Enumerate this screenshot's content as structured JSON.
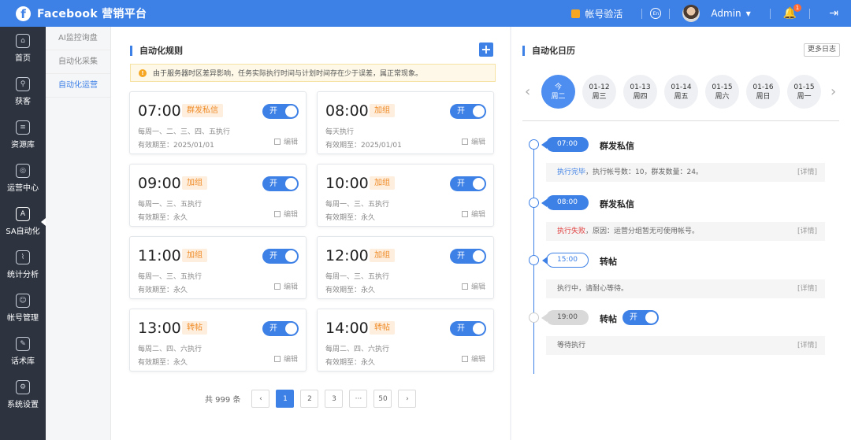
{
  "header": {
    "logo": "f",
    "title": "Facebook 营销平台",
    "verify": "帐号验活",
    "lang": "En",
    "user": "Admin",
    "bell_count": "1"
  },
  "sidebar": {
    "items": [
      {
        "label": "首页",
        "icon": "home-icon"
      },
      {
        "label": "获客",
        "icon": "acquire-icon"
      },
      {
        "label": "资源库",
        "icon": "database-icon"
      },
      {
        "label": "运营中心",
        "icon": "operation-icon"
      },
      {
        "label": "SA自动化",
        "icon": "automation-icon"
      },
      {
        "label": "统计分析",
        "icon": "chart-icon"
      },
      {
        "label": "帐号管理",
        "icon": "account-icon"
      },
      {
        "label": "话术库",
        "icon": "script-icon"
      },
      {
        "label": "系统设置",
        "icon": "settings-icon"
      }
    ],
    "active_index": 4
  },
  "subnav": {
    "items": [
      "AI监控询盘",
      "自动化采集",
      "自动化运营"
    ],
    "active_index": 2
  },
  "rules": {
    "title": "自动化规则",
    "notice": "由于服务器时区差异影响，任务实际执行时间与计划时间存在少于误差，属正常现象。",
    "cards": [
      {
        "time": "07:00",
        "tag": "群发私信",
        "toggle": "开",
        "schedule": "每周一、二、三、四、五执行",
        "valid": "有效期至：2025/01/01",
        "edit": "编辑"
      },
      {
        "time": "08:00",
        "tag": "加组",
        "toggle": "开",
        "schedule": "每天执行",
        "valid": "有效期至：2025/01/01",
        "edit": "编辑"
      },
      {
        "time": "09:00",
        "tag": "加组",
        "toggle": "开",
        "schedule": "每周一、三、五执行",
        "valid": "有效期至：永久",
        "edit": "编辑"
      },
      {
        "time": "10:00",
        "tag": "加组",
        "toggle": "开",
        "schedule": "每周一、三、五执行",
        "valid": "有效期至：永久",
        "edit": "编辑"
      },
      {
        "time": "11:00",
        "tag": "加组",
        "toggle": "开",
        "schedule": "每周一、三、五执行",
        "valid": "有效期至：永久",
        "edit": "编辑"
      },
      {
        "time": "12:00",
        "tag": "加组",
        "toggle": "开",
        "schedule": "每周一、三、五执行",
        "valid": "有效期至：永久",
        "edit": "编辑"
      },
      {
        "time": "13:00",
        "tag": "转帖",
        "toggle": "开",
        "schedule": "每周二、四、六执行",
        "valid": "有效期至：永久",
        "edit": "编辑"
      },
      {
        "time": "14:00",
        "tag": "转帖",
        "toggle": "开",
        "schedule": "每周二、四、六执行",
        "valid": "有效期至：永久",
        "edit": "编辑"
      }
    ],
    "pagination": {
      "total": "共 999 条",
      "prev": "‹",
      "pages": [
        "1",
        "2",
        "3",
        "···",
        "50"
      ],
      "active_page": "1",
      "next": "›"
    }
  },
  "calendar": {
    "title": "自动化日历",
    "more": "更多日志",
    "days": [
      {
        "date": "今",
        "weekday": "周二"
      },
      {
        "date": "01-12",
        "weekday": "周三"
      },
      {
        "date": "01-13",
        "weekday": "周四"
      },
      {
        "date": "01-14",
        "weekday": "周五"
      },
      {
        "date": "01-15",
        "weekday": "周六"
      },
      {
        "date": "01-16",
        "weekday": "周日"
      },
      {
        "date": "01-15",
        "weekday": "周一"
      }
    ],
    "active_day": 0,
    "timeline": [
      {
        "time": "07:00",
        "status": "done",
        "title": "群发私信",
        "status_text": "执行完毕",
        "message": "，执行帐号数：10，群发数量：24。",
        "detail": "[详情]"
      },
      {
        "time": "08:00",
        "status": "done",
        "title": "群发私信",
        "status_text": "执行失败",
        "message": "，原因：运营分组暂无可使用帐号。",
        "detail": "[详情]"
      },
      {
        "time": "15:00",
        "status": "running",
        "title": "转帖",
        "status_text": "",
        "message": "执行中，请耐心等待。",
        "detail": "[详情]"
      },
      {
        "time": "19:00",
        "status": "wait",
        "title": "转帖",
        "toggle": "开",
        "status_text": "",
        "message": "等待执行",
        "detail": "[详情]"
      }
    ]
  },
  "colors": {
    "primary": "#3d80e6",
    "sidebar": "#2d3440",
    "tag_bg": "#fdeede",
    "tag_text": "#f08a24",
    "fail": "#e03b3b"
  }
}
